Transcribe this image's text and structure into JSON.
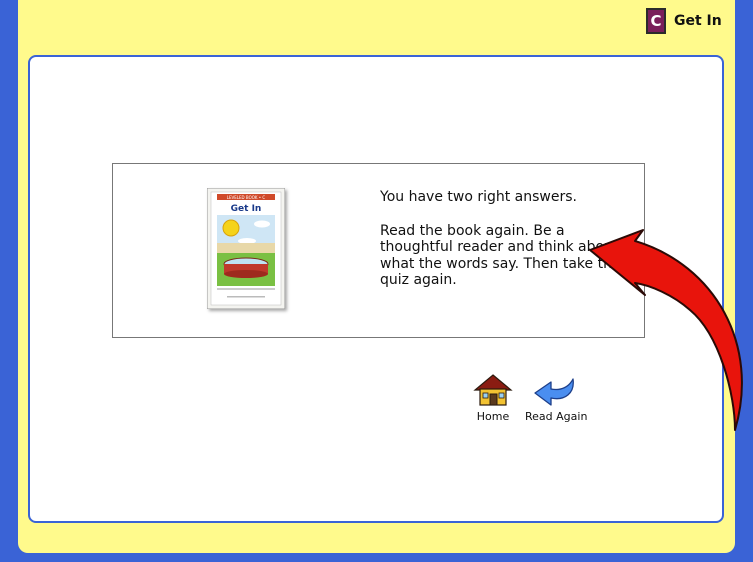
{
  "header": {
    "level_letter": "C",
    "book_title": "Get In"
  },
  "book_cover": {
    "banner_text": "LEVELED BOOK • C",
    "title": "Get In"
  },
  "feedback": {
    "line1": "You have two right answers.",
    "line2": "Read the book again. Be a thoughtful reader and think about what the words say. Then take the quiz again."
  },
  "nav": {
    "home_label": "Home",
    "read_again_label": "Read Again"
  },
  "colors": {
    "background": "#3a63d6",
    "frame": "#fffa8c",
    "level_badge": "#7a1e5a",
    "arrow": "#e8140c"
  },
  "icons": {
    "home": "house-icon",
    "read_again": "return-arrow-icon",
    "indicator": "curved-arrow-icon"
  }
}
